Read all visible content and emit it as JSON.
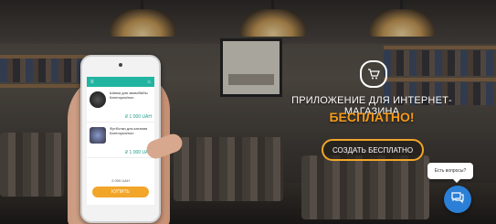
{
  "phone_app": {
    "header_left": "≡",
    "header_right": "⌂",
    "products": [
      {
        "name": "Шапка для зимы/бабы\nКатегория/пол",
        "price": "₽ 1 000 UAH"
      },
      {
        "name": "Футболки для катания\nКатегория/пол",
        "price": "₽ 1 000 UAH"
      }
    ],
    "total": "2 000 UAH",
    "buy_label": "КУПИТЬ"
  },
  "hero": {
    "headline": "ПРИЛОЖЕНИЕ ДЛЯ ИНТЕРНЕТ-МАГАЗИНА",
    "subheadline": "БЕСПЛАТНО!",
    "cta_label": "СОЗДАТЬ БЕСПЛАТНО"
  },
  "chat": {
    "bubble_text": "Есть вопросы?"
  },
  "icons": {
    "cart": "cart-icon",
    "chat": "chat-icon"
  },
  "colors": {
    "accent": "#f1a62a",
    "teal": "#21b5a1",
    "chat_blue": "#2b7fd6"
  }
}
